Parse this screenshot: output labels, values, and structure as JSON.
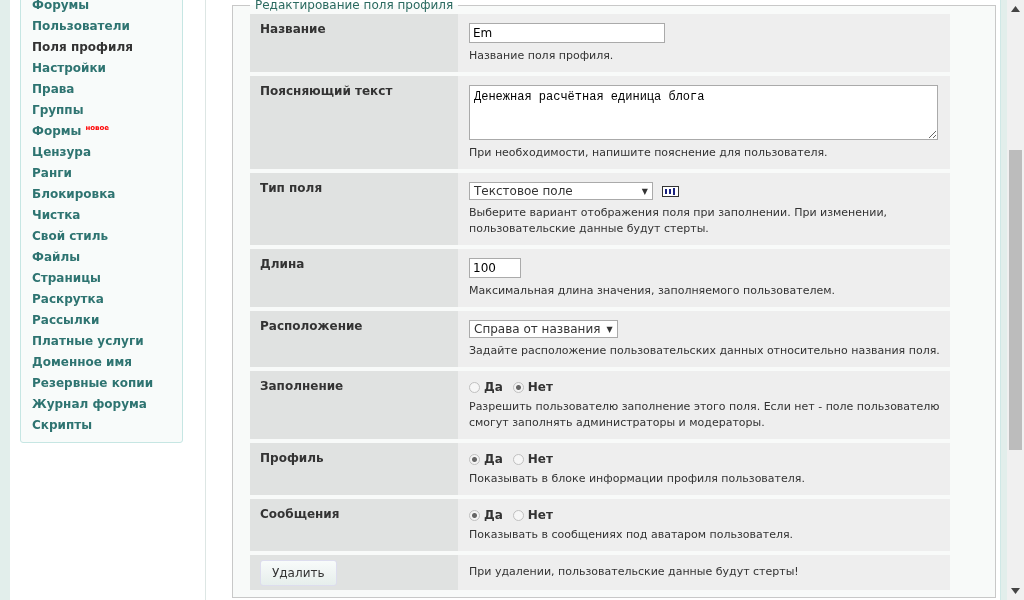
{
  "sidebar": {
    "items": [
      {
        "label": "Форумы",
        "selected": false
      },
      {
        "label": "Пользователи",
        "selected": false
      },
      {
        "label": "Поля профиля",
        "selected": true
      },
      {
        "label": "Настройки",
        "selected": false
      },
      {
        "label": "Права",
        "selected": false
      },
      {
        "label": "Группы",
        "selected": false
      },
      {
        "label": "Формы",
        "selected": false,
        "badge": "новое"
      },
      {
        "label": "Цензура",
        "selected": false
      },
      {
        "label": "Ранги",
        "selected": false
      },
      {
        "label": "Блокировка",
        "selected": false
      },
      {
        "label": "Чистка",
        "selected": false
      },
      {
        "label": "Свой стиль",
        "selected": false
      },
      {
        "label": "Файлы",
        "selected": false
      },
      {
        "label": "Страницы",
        "selected": false
      },
      {
        "label": "Раскрутка",
        "selected": false
      },
      {
        "label": "Рассылки",
        "selected": false
      },
      {
        "label": "Платные услуги",
        "selected": false
      },
      {
        "label": "Доменное имя",
        "selected": false
      },
      {
        "label": "Резервные копии",
        "selected": false
      },
      {
        "label": "Журнал форума",
        "selected": false
      },
      {
        "label": "Скрипты",
        "selected": false
      }
    ]
  },
  "form": {
    "legend": "Редактирование поля профиля",
    "rows": [
      {
        "kind": "text",
        "label": "Название",
        "value": "Em",
        "hint": "Название поля профиля."
      },
      {
        "kind": "textarea",
        "label": "Поясняющий текст",
        "value": "Денежная расчётная единица блога",
        "hint": "При необходимости, напишите пояснение для пользователя."
      },
      {
        "kind": "select",
        "label": "Тип поля",
        "value": "Текстовое поле",
        "arrow": "▼",
        "hint": "Выберите вариант отображения поля при заполнении. При изменении, пользовательские данные будут стерты."
      },
      {
        "kind": "short",
        "label": "Длина",
        "value": "100",
        "hint": "Максимальная длина значения, заполняемого пользователем."
      },
      {
        "kind": "select2",
        "label": "Расположение",
        "value": "Справа от названия",
        "arrow": "▼",
        "hint": "Задайте расположение пользовательских данных относительно названия поля."
      },
      {
        "kind": "radio",
        "label": "Заполнение",
        "options": [
          {
            "label": "Да",
            "selected": false
          },
          {
            "label": "Нет",
            "selected": true
          }
        ],
        "hint": "Разрешить пользователю заполнение этого поля. Если нет - поле пользователю смогут заполнять администраторы и модераторы."
      },
      {
        "kind": "radio",
        "label": "Профиль",
        "options": [
          {
            "label": "Да",
            "selected": true
          },
          {
            "label": "Нет",
            "selected": false
          }
        ],
        "hint": "Показывать в блоке информации профиля пользователя."
      },
      {
        "kind": "radio",
        "label": "Сообщения",
        "options": [
          {
            "label": "Да",
            "selected": true
          },
          {
            "label": "Нет",
            "selected": false
          }
        ],
        "hint": "Показывать в сообщениях под аватаром пользователя."
      },
      {
        "kind": "button",
        "label": "Удалить",
        "hint": "При удалении, пользовательские данные будут стерты!"
      }
    ]
  }
}
